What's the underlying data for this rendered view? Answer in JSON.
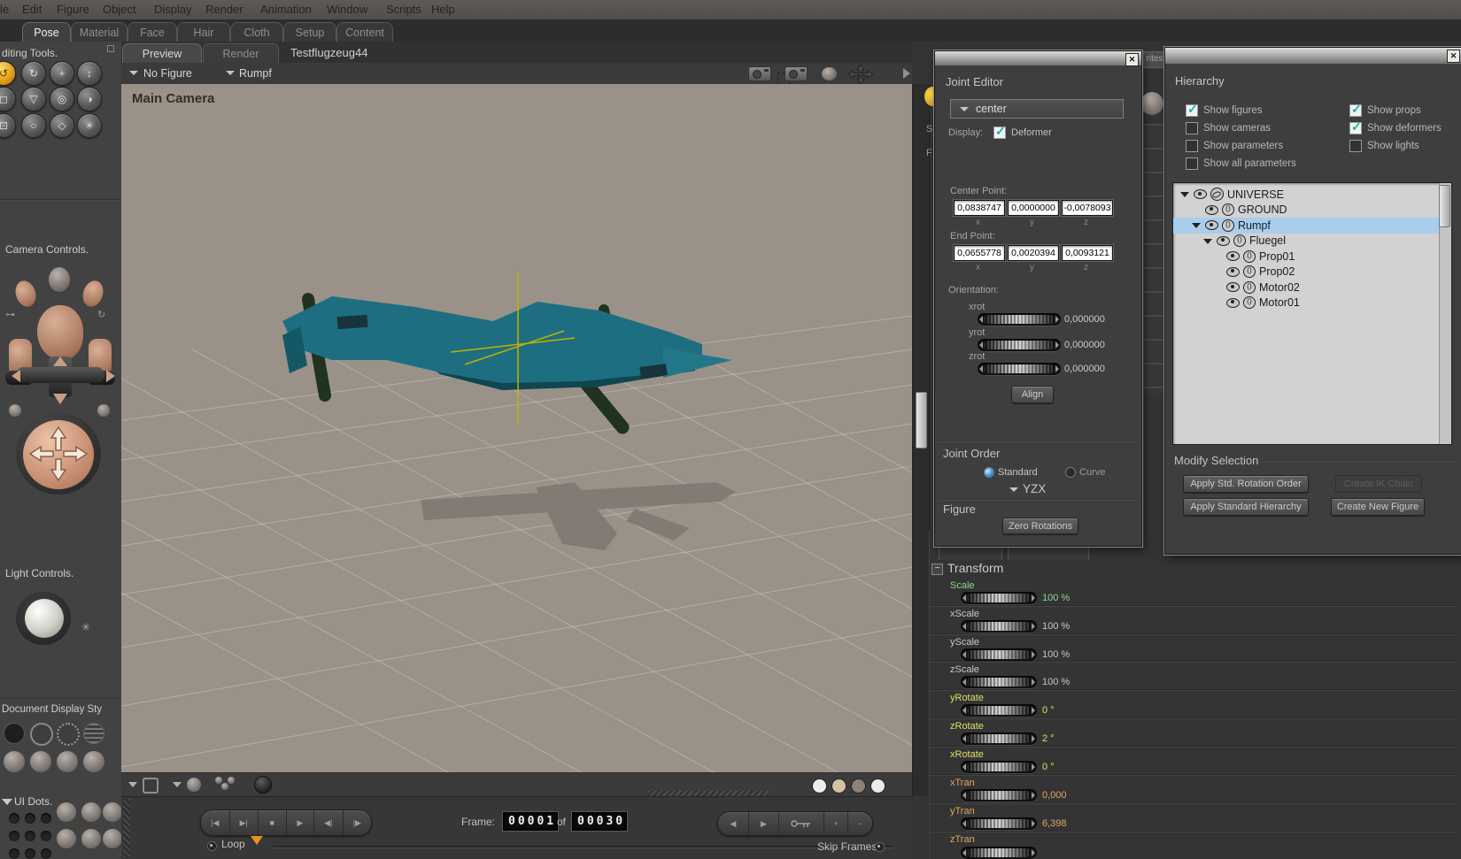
{
  "menu": {
    "items": [
      "le",
      "Edit",
      "Figure",
      "Object",
      "Display",
      "Render",
      "Animation",
      "Window",
      "Scripts",
      "Help"
    ]
  },
  "mode_tabs": [
    {
      "label": "Pose",
      "active": true
    },
    {
      "label": "Material",
      "active": false
    },
    {
      "label": "Face",
      "active": false
    },
    {
      "label": "Hair",
      "active": false
    },
    {
      "label": "Cloth",
      "active": false
    },
    {
      "label": "Setup",
      "active": false
    },
    {
      "label": "Content",
      "active": false
    }
  ],
  "sidebar": {
    "editing_tools_label": "diting Tools.",
    "camera_controls_label": "Camera Controls.",
    "light_controls_label": "Light Controls.",
    "document_display_label": "Document Display Sty",
    "ui_dots_label": "UI Dots."
  },
  "document": {
    "tabs": [
      {
        "label": "Preview",
        "active": true
      },
      {
        "label": "Render",
        "active": false
      }
    ],
    "title": "Testflugzeug44",
    "figure_selector": "No Figure",
    "actor_selector": "Rumpf",
    "camera_label": "Main Camera"
  },
  "playback": {
    "frame_label": "Frame:",
    "current_frame": "00001",
    "of_label": "of",
    "total_frames": "00030",
    "loop_label": "Loop",
    "skip_frames_label": "Skip Frames",
    "transport": [
      "|◀",
      "▶|",
      "■",
      "▶",
      "◀|",
      "|▶"
    ],
    "frame_buttons": {
      "prev": "◀",
      "next": "▶",
      "plus": "+",
      "minus": "−"
    }
  },
  "joint_editor": {
    "title": "Joint Editor",
    "part_selector": "center",
    "display_label": "Display:",
    "deformer_label": "Deformer",
    "deformer_checked": true,
    "center_point": {
      "label": "Center Point:",
      "x": "0,0838747",
      "y": "0,0000000",
      "z": "-0,0078093"
    },
    "end_point": {
      "label": "End Point:",
      "x": "0,0655778",
      "y": "0,0020394",
      "z": "0,0093121"
    },
    "axis_labels": [
      "x",
      "y",
      "z"
    ],
    "orientation_label": "Orientation:",
    "orientation": [
      {
        "name": "xrot",
        "value": "0,000000"
      },
      {
        "name": "yrot",
        "value": "0,000000"
      },
      {
        "name": "zrot",
        "value": "0,000000"
      }
    ],
    "align_button": "Align",
    "joint_order": {
      "label": "Joint Order",
      "standard": "Standard",
      "curve": "Curve",
      "selected": "Standard",
      "order": "YZX"
    },
    "figure_section": {
      "label": "Figure",
      "zero_rotations_button": "Zero Rotations"
    }
  },
  "hierarchy": {
    "title": "Hierarchy",
    "checkboxes_left": [
      {
        "label": "Show figures",
        "checked": true
      },
      {
        "label": "Show cameras",
        "checked": false
      },
      {
        "label": "Show parameters",
        "checked": false
      },
      {
        "label": "Show all parameters",
        "checked": false
      }
    ],
    "checkboxes_right": [
      {
        "label": "Show props",
        "checked": true
      },
      {
        "label": "Show deformers",
        "checked": true
      },
      {
        "label": "Show lights",
        "checked": false
      }
    ],
    "tree": [
      {
        "label": "UNIVERSE",
        "indent": 0,
        "icon": "globe",
        "selected": false
      },
      {
        "label": "GROUND",
        "indent": 1,
        "icon": "figure",
        "selected": false
      },
      {
        "label": "Rumpf",
        "indent": 1,
        "icon": "figure",
        "selected": true
      },
      {
        "label": "Fluegel",
        "indent": 2,
        "icon": "figure",
        "selected": false
      },
      {
        "label": "Prop01",
        "indent": 3,
        "icon": "figure",
        "selected": false
      },
      {
        "label": "Prop02",
        "indent": 3,
        "icon": "figure",
        "selected": false
      },
      {
        "label": "Motor02",
        "indent": 3,
        "icon": "figure",
        "selected": false
      },
      {
        "label": "Motor01",
        "indent": 3,
        "icon": "figure",
        "selected": false
      }
    ],
    "modify_selection": {
      "label": "Modify Selection",
      "buttons": [
        {
          "label": "Apply Std. Rotation Order",
          "enabled": true
        },
        {
          "label": "Create IK Chain",
          "enabled": false
        },
        {
          "label": "Apply Standard Hierarchy",
          "enabled": true
        },
        {
          "label": "Create New Figure",
          "enabled": true
        }
      ]
    }
  },
  "transform": {
    "title": "Transform",
    "params": [
      {
        "label": "Scale",
        "value": "100 %",
        "color": "#8fd48f"
      },
      {
        "label": "xScale",
        "value": "100 %",
        "color": "#c8c8c8"
      },
      {
        "label": "yScale",
        "value": "100 %",
        "color": "#c8c8c8"
      },
      {
        "label": "zScale",
        "value": "100 %",
        "color": "#c8c8c8"
      },
      {
        "label": "yRotate",
        "value": "0 °",
        "color": "#e0e060"
      },
      {
        "label": "zRotate",
        "value": "2 °",
        "color": "#e0e060"
      },
      {
        "label": "xRotate",
        "value": "0 °",
        "color": "#e0e060"
      },
      {
        "label": "xTran",
        "value": "0,000",
        "color": "#e0a860"
      },
      {
        "label": "yTran",
        "value": "6,398",
        "color": "#e0a860"
      },
      {
        "label": "zTran",
        "value": "",
        "color": "#e0a860"
      }
    ]
  },
  "misc": {
    "rites_tab": "rites",
    "s_label": "S",
    "f_label": "F",
    "close_glyph": "✕"
  },
  "colors": {
    "selection_blue": "#a9cdec",
    "check_teal": "#17b3a6",
    "radio_blue": "#2f90d2",
    "marker_orange": "#e89020",
    "model_teal": "#1d6e80",
    "viewport_bg": "#9a9289"
  }
}
